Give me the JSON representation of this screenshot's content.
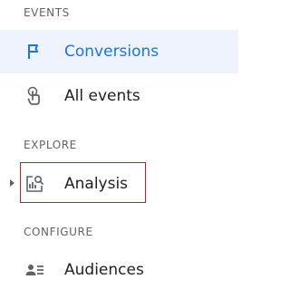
{
  "sections": {
    "events": "EVENTS",
    "explore": "EXPLORE",
    "configure": "CONFIGURE"
  },
  "items": {
    "conversions": {
      "label": "Conversions",
      "icon": "flag-icon",
      "selected": true
    },
    "all_events": {
      "label": "All events",
      "icon": "touch-icon"
    },
    "analysis": {
      "label": "Analysis",
      "icon": "analysis-icon"
    },
    "audiences": {
      "label": "Audiences",
      "icon": "audiences-icon"
    }
  },
  "colors": {
    "accent": "#1a73e8",
    "selected_bg": "#eef3fd",
    "highlight_border": "#b3262b",
    "text": "#202124",
    "muted": "#5f6368"
  }
}
